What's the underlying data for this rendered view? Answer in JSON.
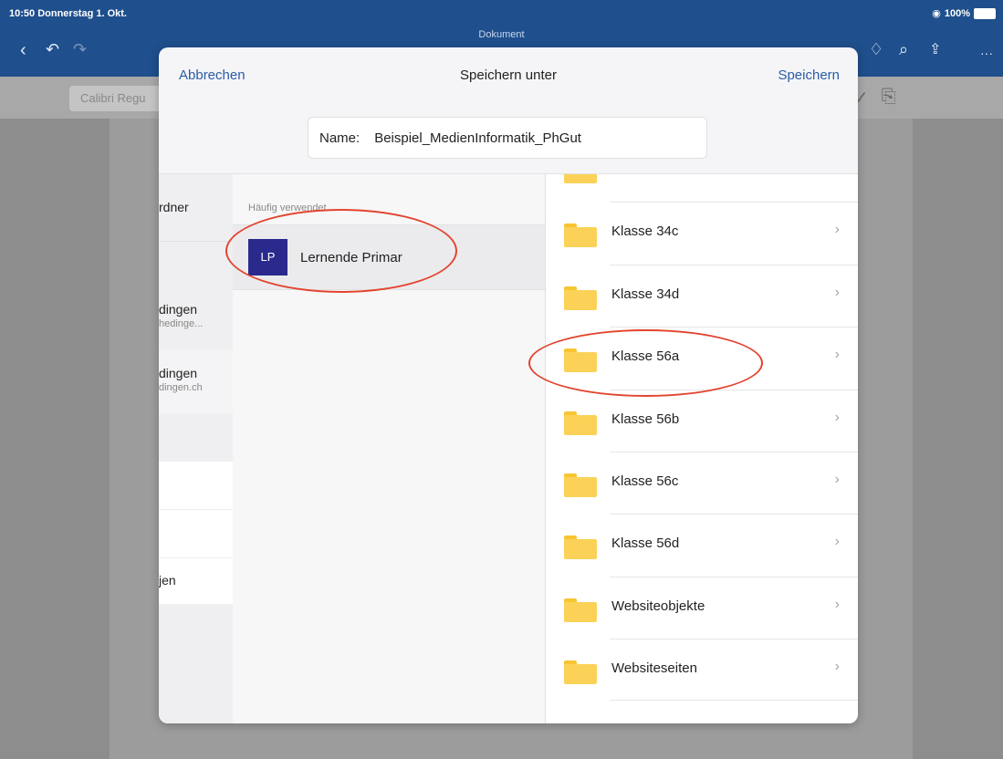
{
  "status": {
    "time_date": "10:50  Donnerstag 1. Okt.",
    "battery": "100%"
  },
  "document": {
    "title": "Dokument"
  },
  "ribbon": {
    "font_name": "Calibri Regu"
  },
  "dialog": {
    "cancel_label": "Abbrechen",
    "title": "Speichern unter",
    "save_label": "Speichern",
    "name_label": "Name:",
    "name_value": "Beispiel_MedienInformatik_PhGut"
  },
  "left_pane": {
    "items": [
      {
        "label": "rdner"
      },
      {
        "label": "dingen",
        "sub": "hedinge..."
      },
      {
        "label": "dingen",
        "sub": "dingen.ch"
      },
      {
        "label": "jen"
      }
    ]
  },
  "middle_pane": {
    "section_label": "Häufig verwendet",
    "recent": {
      "initials": "LP",
      "name": "Lernende Primar"
    }
  },
  "folders": [
    {
      "name": "Klasse 34c"
    },
    {
      "name": "Klasse 34d"
    },
    {
      "name": "Klasse 56a"
    },
    {
      "name": "Klasse 56b"
    },
    {
      "name": "Klasse 56c"
    },
    {
      "name": "Klasse 56d"
    },
    {
      "name": "Websiteobjekte"
    },
    {
      "name": "Websiteseiten"
    }
  ],
  "colors": {
    "accent": "#2b5ba5",
    "toolbar": "#1f4f8c",
    "folder": "#fbd257",
    "annotation": "#e2452f",
    "avatar": "#2a2a8c"
  }
}
